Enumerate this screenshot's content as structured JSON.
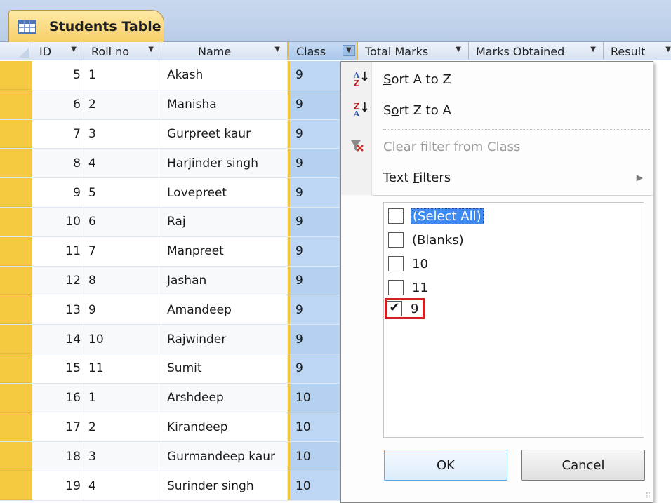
{
  "tab": {
    "title": "Students Table"
  },
  "columns": [
    "ID",
    "Roll no",
    "Name",
    "Class",
    "Total Marks",
    "Marks Obtained",
    "Result"
  ],
  "rows": [
    {
      "id": "5",
      "roll": "1",
      "name": "Akash",
      "class": "9"
    },
    {
      "id": "6",
      "roll": "2",
      "name": "Manisha",
      "class": "9"
    },
    {
      "id": "7",
      "roll": "3",
      "name": "Gurpreet kaur",
      "class": "9"
    },
    {
      "id": "8",
      "roll": "4",
      "name": "Harjinder singh",
      "class": "9"
    },
    {
      "id": "9",
      "roll": "5",
      "name": "Lovepreet",
      "class": "9"
    },
    {
      "id": "10",
      "roll": "6",
      "name": "Raj",
      "class": "9"
    },
    {
      "id": "11",
      "roll": "7",
      "name": "Manpreet",
      "class": "9"
    },
    {
      "id": "12",
      "roll": "8",
      "name": "Jashan",
      "class": "9"
    },
    {
      "id": "13",
      "roll": "9",
      "name": "Amandeep",
      "class": "9"
    },
    {
      "id": "14",
      "roll": "10",
      "name": "Rajwinder",
      "class": "9"
    },
    {
      "id": "15",
      "roll": "11",
      "name": "Sumit",
      "class": "9"
    },
    {
      "id": "16",
      "roll": "1",
      "name": "Arshdeep",
      "class": "10"
    },
    {
      "id": "17",
      "roll": "2",
      "name": "Kirandeep",
      "class": "10"
    },
    {
      "id": "18",
      "roll": "3",
      "name": "Gurmandeep kaur",
      "class": "10"
    },
    {
      "id": "19",
      "roll": "4",
      "name": "Surinder singh",
      "class": "10"
    }
  ],
  "menu": {
    "sort_az_pre": "",
    "sort_az_key": "S",
    "sort_az_post": "ort A to Z",
    "sort_za_pre": "S",
    "sort_za_key": "o",
    "sort_za_post": "rt Z to A",
    "clear_pre": "C",
    "clear_key": "l",
    "clear_post": "ear filter from Class",
    "text_filters_pre": "Text ",
    "text_filters_key": "F",
    "text_filters_post": "ilters",
    "sort_az_icon_top": "A",
    "sort_az_icon_bottom": "Z",
    "sort_za_icon_top": "Z",
    "sort_za_icon_bottom": "A",
    "checklist": [
      {
        "label": "(Select All)",
        "checked": false
      },
      {
        "label": "(Blanks)",
        "checked": false
      },
      {
        "label": "10",
        "checked": false
      },
      {
        "label": "11",
        "checked": false
      },
      {
        "label": "9",
        "checked": true
      }
    ],
    "ok_label": "OK",
    "cancel_label": "Cancel",
    "check_mark": "✔",
    "arrow": "▶",
    "dropdown_arrow": "▾"
  }
}
